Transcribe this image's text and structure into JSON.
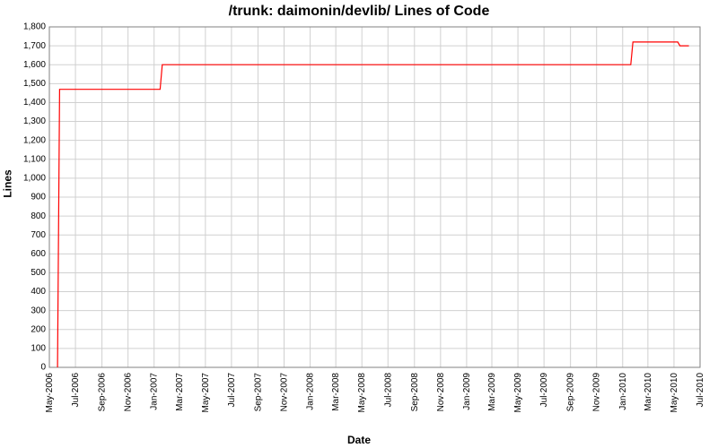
{
  "chart_data": {
    "type": "line",
    "title": "/trunk: daimonin/devlib/ Lines of Code",
    "xlabel": "Date",
    "ylabel": "Lines",
    "ylim": [
      0,
      1800
    ],
    "y_ticks": [
      0,
      100,
      200,
      300,
      400,
      500,
      600,
      700,
      800,
      900,
      1000,
      1100,
      1200,
      1300,
      1400,
      1500,
      1600,
      1700,
      1800
    ],
    "y_tick_labels": [
      "0",
      "100",
      "200",
      "300",
      "400",
      "500",
      "600",
      "700",
      "800",
      "900",
      "1,000",
      "1,100",
      "1,200",
      "1,300",
      "1,400",
      "1,500",
      "1,600",
      "1,700",
      "1,800"
    ],
    "x_categories": [
      "May-2006",
      "Jul-2006",
      "Sep-2006",
      "Nov-2006",
      "Jan-2007",
      "Mar-2007",
      "May-2007",
      "Jul-2007",
      "Sep-2007",
      "Nov-2007",
      "Jan-2008",
      "Mar-2008",
      "May-2008",
      "Jul-2008",
      "Sep-2008",
      "Nov-2008",
      "Jan-2009",
      "Mar-2009",
      "May-2009",
      "Jul-2009",
      "Sep-2009",
      "Nov-2009",
      "Jan-2010",
      "Mar-2010",
      "May-2010",
      "Jul-2010"
    ],
    "series": [
      {
        "name": "Lines of Code",
        "color": "#ff0000",
        "points": [
          {
            "x": "2006-05-20",
            "y": 0
          },
          {
            "x": "2006-05-25",
            "y": 1470
          },
          {
            "x": "2007-01-15",
            "y": 1470
          },
          {
            "x": "2007-01-20",
            "y": 1600
          },
          {
            "x": "2010-01-20",
            "y": 1600
          },
          {
            "x": "2010-01-25",
            "y": 1720
          },
          {
            "x": "2010-05-10",
            "y": 1720
          },
          {
            "x": "2010-05-15",
            "y": 1700
          },
          {
            "x": "2010-06-05",
            "y": 1700
          }
        ]
      }
    ]
  }
}
